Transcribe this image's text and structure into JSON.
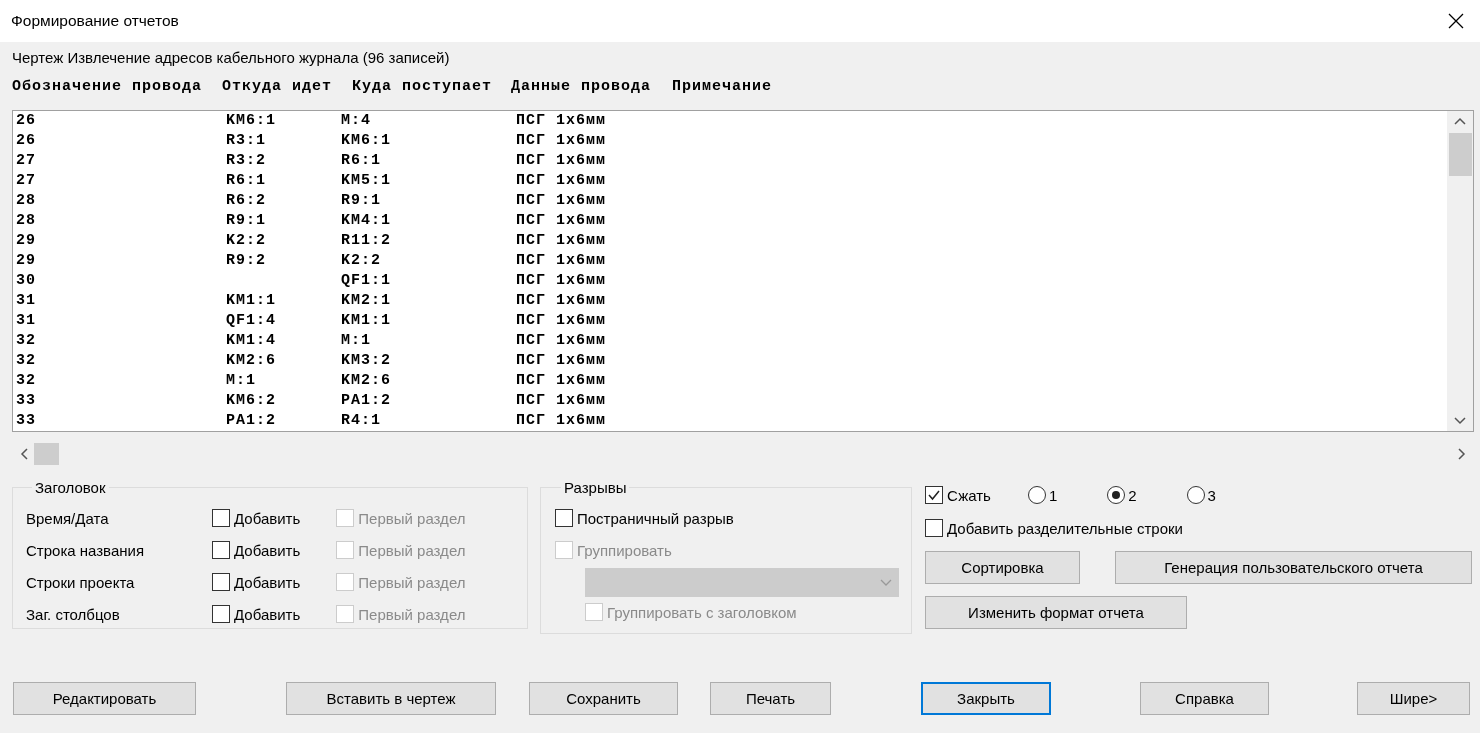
{
  "window": {
    "title": "Формирование отчетов"
  },
  "caption": "Чертеж Извлечение адресов кабельного журнала (96 записей)",
  "columns": [
    "Обозначение провода",
    "Откуда идет",
    "Куда поступает",
    "Данные провода",
    "Примечание"
  ],
  "rows": [
    {
      "wire": "26",
      "from": "KM6:1",
      "to": "M:4",
      "data": "ПСГ 1x6мм"
    },
    {
      "wire": "26",
      "from": "R3:1",
      "to": "KM6:1",
      "data": "ПСГ 1x6мм"
    },
    {
      "wire": "27",
      "from": "R3:2",
      "to": "R6:1",
      "data": "ПСГ 1x6мм"
    },
    {
      "wire": "27",
      "from": "R6:1",
      "to": "KM5:1",
      "data": "ПСГ 1x6мм"
    },
    {
      "wire": "28",
      "from": "R6:2",
      "to": "R9:1",
      "data": "ПСГ 1x6мм"
    },
    {
      "wire": "28",
      "from": "R9:1",
      "to": "KM4:1",
      "data": "ПСГ 1x6мм"
    },
    {
      "wire": "29",
      "from": "K2:2",
      "to": "R11:2",
      "data": "ПСГ 1x6мм"
    },
    {
      "wire": "29",
      "from": "R9:2",
      "to": "K2:2",
      "data": "ПСГ 1x6мм"
    },
    {
      "wire": "30",
      "to": "QF1:1",
      "data": "ПСГ 1x6мм"
    },
    {
      "wire": "31",
      "from": "KM1:1",
      "to": "KM2:1",
      "data": "ПСГ 1x6мм"
    },
    {
      "wire": "31",
      "from": "QF1:4",
      "to": "KM1:1",
      "data": "ПСГ 1x6мм"
    },
    {
      "wire": "32",
      "from": "KM1:4",
      "to": "M:1",
      "data": "ПСГ 1x6мм"
    },
    {
      "wire": "32",
      "from": "KM2:6",
      "to": "KM3:2",
      "data": "ПСГ 1x6мм"
    },
    {
      "wire": "32",
      "from": "M:1",
      "to": "KM2:6",
      "data": "ПСГ 1x6мм"
    },
    {
      "wire": "33",
      "from": "KM6:2",
      "to": "PA1:2",
      "data": "ПСГ 1x6мм"
    },
    {
      "wire": "33",
      "from": "PA1:2",
      "to": "R4:1",
      "data": "ПСГ 1x6мм"
    }
  ],
  "header_group": {
    "legend": "Заголовок",
    "rows": [
      {
        "label": "Время/Дата",
        "add": {
          "label": "Добавить",
          "checked": false
        },
        "first": {
          "label": "Первый раздел",
          "checked": false,
          "disabled": true
        }
      },
      {
        "label": "Строка названия",
        "add": {
          "label": "Добавить",
          "checked": false
        },
        "first": {
          "label": "Первый раздел",
          "checked": false,
          "disabled": true
        }
      },
      {
        "label": "Строки проекта",
        "add": {
          "label": "Добавить",
          "checked": false
        },
        "first": {
          "label": "Первый раздел",
          "checked": false,
          "disabled": true
        }
      },
      {
        "label": "Заг. столбцов",
        "add": {
          "label": "Добавить",
          "checked": false
        },
        "first": {
          "label": "Первый раздел",
          "checked": false,
          "disabled": true
        }
      }
    ]
  },
  "breaks": {
    "legend": "Разрывы",
    "page_break": {
      "label": "Постраничный разрыв",
      "checked": false,
      "disabled": false
    },
    "group": {
      "label": "Группировать",
      "checked": false,
      "disabled": true
    },
    "group_select": {
      "disabled": true
    },
    "group_with_header": {
      "label": "Группировать с заголовком",
      "checked": false,
      "disabled": true
    }
  },
  "compress": {
    "label": "Сжать",
    "checked": true
  },
  "radios": [
    {
      "label": "1",
      "selected": false
    },
    {
      "label": "2",
      "selected": true
    },
    {
      "label": "3",
      "selected": false
    }
  ],
  "separator_rows": {
    "label": "Добавить разделительные строки",
    "checked": false
  },
  "side_buttons": [
    "Сортировка",
    "Генерация пользовательского отчета",
    "Изменить формат отчета"
  ],
  "bottom_buttons": [
    {
      "label": "Редактировать",
      "default": false
    },
    {
      "label": "Вставить в чертеж",
      "default": false
    },
    {
      "label": "Сохранить",
      "default": false
    },
    {
      "label": "Печать",
      "default": false
    },
    {
      "label": "Закрыть",
      "default": true
    },
    {
      "label": "Справка",
      "default": false
    },
    {
      "label": "Шире>",
      "default": false
    }
  ]
}
